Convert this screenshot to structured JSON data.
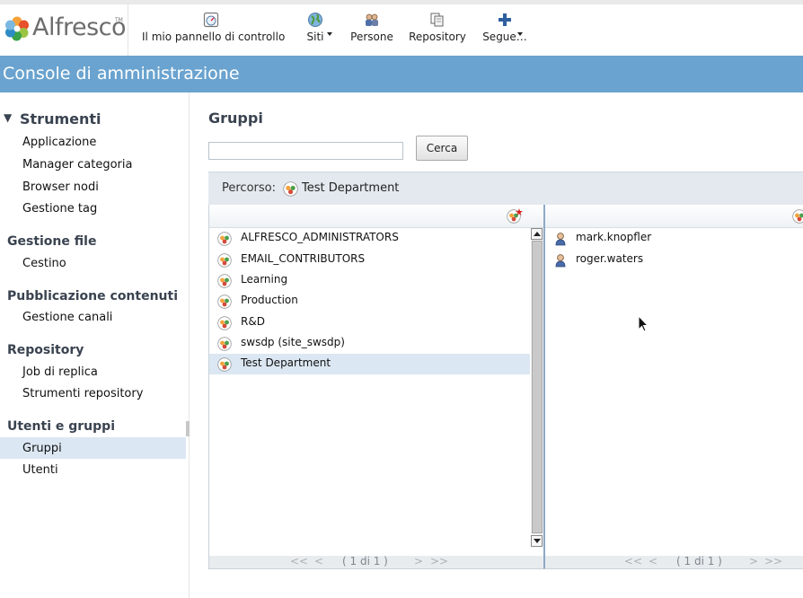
{
  "header": {
    "logo_text": "Alfresco",
    "logo_tm": "TM",
    "nav": [
      {
        "label": "Il mio pannello di controllo",
        "icon": "dashboard-icon"
      },
      {
        "label": "Siti",
        "icon": "globe-icon"
      },
      {
        "label": "Persone",
        "icon": "people-icon"
      },
      {
        "label": "Repository",
        "icon": "repository-icon"
      },
      {
        "label": "Segue…",
        "icon": "plus-icon"
      }
    ]
  },
  "title": "Console di amministrazione",
  "sidebar": {
    "tools_header": "Strumenti",
    "tools_items": [
      "Applicazione",
      "Manager categoria",
      "Browser nodi",
      "Gestione tag"
    ],
    "file_header": "Gestione file",
    "file_items": [
      "Cestino"
    ],
    "pub_header": "Pubblicazione contenuti",
    "pub_items": [
      "Gestione canali"
    ],
    "repo_header": "Repository",
    "repo_items": [
      "Job di replica",
      "Strumenti repository"
    ],
    "users_header": "Utenti e gruppi",
    "users_items": [
      "Gruppi",
      "Utenti"
    ],
    "selected": "Gruppi"
  },
  "main": {
    "title": "Gruppi",
    "search": {
      "value": "",
      "button": "Cerca"
    },
    "path": {
      "label": "Percorso:",
      "value": "Test Department"
    },
    "groups": [
      "ALFRESCO_ADMINISTRATORS",
      "EMAIL_CONTRIBUTORS",
      "Learning",
      "Production",
      "R&D",
      "swsdp (site_swsdp)",
      "Test Department"
    ],
    "selected_group": "Test Department",
    "members": [
      "mark.knopfler",
      "roger.waters"
    ],
    "pager": {
      "first": "<<",
      "prev": "<",
      "page": "( 1 di 1 )",
      "next": ">",
      "last": ">>"
    }
  },
  "colors": {
    "title_band": "#6aa3cf",
    "selected_row": "#dbe7f2",
    "heading": "#3a4350"
  }
}
